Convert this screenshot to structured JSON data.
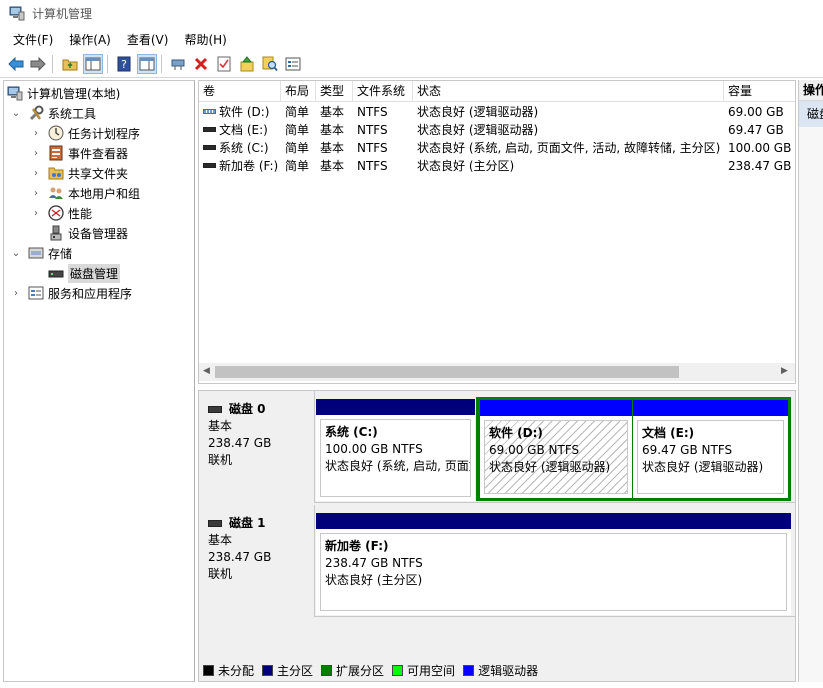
{
  "window": {
    "title": "计算机管理"
  },
  "menu": [
    "文件(F)",
    "操作(A)",
    "查看(V)",
    "帮助(H)"
  ],
  "toolbar": {
    "icons": [
      "back-arrow-icon",
      "forward-arrow-icon",
      "up-folder-icon",
      "show-hide-tree-icon",
      "help-icon",
      "show-action-pane-icon",
      "connect-icon",
      "delete-icon",
      "properties-icon",
      "move-up-icon",
      "search-icon",
      "console-icon"
    ]
  },
  "tree": {
    "root": "计算机管理(本地)",
    "system_tools": "系统工具",
    "task_scheduler": "任务计划程序",
    "event_viewer": "事件查看器",
    "shared_folders": "共享文件夹",
    "local_users": "本地用户和组",
    "performance": "性能",
    "device_manager": "设备管理器",
    "storage": "存储",
    "disk_management": "磁盘管理",
    "services_apps": "服务和应用程序"
  },
  "columns": [
    "卷",
    "布局",
    "类型",
    "文件系统",
    "状态",
    "容量"
  ],
  "volumes": [
    {
      "name": "软件 (D:)",
      "layout": "简单",
      "type": "基本",
      "fs": "NTFS",
      "status": "状态良好 (逻辑驱动器)",
      "capacity": "69.00 GB"
    },
    {
      "name": "文档 (E:)",
      "layout": "简单",
      "type": "基本",
      "fs": "NTFS",
      "status": "状态良好 (逻辑驱动器)",
      "capacity": "69.47 GB"
    },
    {
      "name": "系统 (C:)",
      "layout": "简单",
      "type": "基本",
      "fs": "NTFS",
      "status": "状态良好 (系统, 启动, 页面文件, 活动, 故障转储, 主分区)",
      "capacity": "100.00 GB"
    },
    {
      "name": "新加卷 (F:)",
      "layout": "简单",
      "type": "基本",
      "fs": "NTFS",
      "status": "状态良好 (主分区)",
      "capacity": "238.47 GB"
    }
  ],
  "disks": [
    {
      "name": "磁盘 0",
      "type": "基本",
      "size": "238.47 GB",
      "state": "联机",
      "partitions": [
        {
          "name": "系统  (C:)",
          "size_fs": "100.00 GB NTFS",
          "status": "状态良好 (系统, 启动, 页面文件, 活动, 故障转储, 主分区)",
          "kind": "primary"
        },
        {
          "name": "软件  (D:)",
          "size_fs": "69.00 GB NTFS",
          "status": "状态良好 (逻辑驱动器)",
          "kind": "logical"
        },
        {
          "name": "文档  (E:)",
          "size_fs": "69.47 GB NTFS",
          "status": "状态良好 (逻辑驱动器)",
          "kind": "logical"
        }
      ]
    },
    {
      "name": "磁盘 1",
      "type": "基本",
      "size": "238.47 GB",
      "state": "联机",
      "partitions": [
        {
          "name": "新加卷  (F:)",
          "size_fs": "238.47 GB NTFS",
          "status": "状态良好 (主分区)",
          "kind": "primary"
        }
      ]
    }
  ],
  "legend": [
    {
      "label": "未分配",
      "color": "#000000"
    },
    {
      "label": "主分区",
      "color": "#00007b"
    },
    {
      "label": "扩展分区",
      "color": "#008000"
    },
    {
      "label": "可用空间",
      "color": "#00ff00"
    },
    {
      "label": "逻辑驱动器",
      "color": "#0000ff"
    }
  ],
  "actions": {
    "header": "操作",
    "item": "磁盘管理"
  }
}
